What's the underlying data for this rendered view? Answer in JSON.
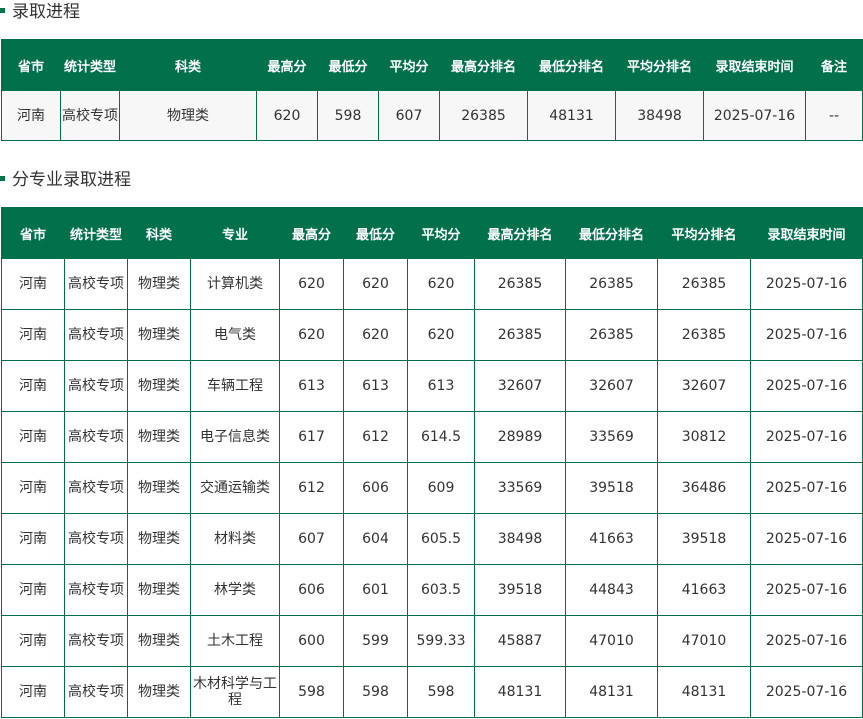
{
  "section1": {
    "title": "录取进程",
    "headers": [
      "省市",
      "统计类型",
      "科类",
      "最高分",
      "最低分",
      "平均分",
      "最高分排名",
      "最低分排名",
      "平均分排名",
      "录取结束时间",
      "备注"
    ],
    "rows": [
      [
        "河南",
        "高校专项",
        "物理类",
        "620",
        "598",
        "607",
        "26385",
        "48131",
        "38498",
        "2025-07-16",
        "--"
      ]
    ]
  },
  "section2": {
    "title": "分专业录取进程",
    "headers": [
      "省市",
      "统计类型",
      "科类",
      "专业",
      "最高分",
      "最低分",
      "平均分",
      "最高分排名",
      "最低分排名",
      "平均分排名",
      "录取结束时间"
    ],
    "rows": [
      [
        "河南",
        "高校专项",
        "物理类",
        "计算机类",
        "620",
        "620",
        "620",
        "26385",
        "26385",
        "26385",
        "2025-07-16"
      ],
      [
        "河南",
        "高校专项",
        "物理类",
        "电气类",
        "620",
        "620",
        "620",
        "26385",
        "26385",
        "26385",
        "2025-07-16"
      ],
      [
        "河南",
        "高校专项",
        "物理类",
        "车辆工程",
        "613",
        "613",
        "613",
        "32607",
        "32607",
        "32607",
        "2025-07-16"
      ],
      [
        "河南",
        "高校专项",
        "物理类",
        "电子信息类",
        "617",
        "612",
        "614.5",
        "28989",
        "33569",
        "30812",
        "2025-07-16"
      ],
      [
        "河南",
        "高校专项",
        "物理类",
        "交通运输类",
        "612",
        "606",
        "609",
        "33569",
        "39518",
        "36486",
        "2025-07-16"
      ],
      [
        "河南",
        "高校专项",
        "物理类",
        "材料类",
        "607",
        "604",
        "605.5",
        "38498",
        "41663",
        "39518",
        "2025-07-16"
      ],
      [
        "河南",
        "高校专项",
        "物理类",
        "林学类",
        "606",
        "601",
        "603.5",
        "39518",
        "44843",
        "41663",
        "2025-07-16"
      ],
      [
        "河南",
        "高校专项",
        "物理类",
        "土木工程",
        "600",
        "599",
        "599.33",
        "45887",
        "47010",
        "47010",
        "2025-07-16"
      ],
      [
        "河南",
        "高校专项",
        "物理类",
        "木材科学与工程",
        "598",
        "598",
        "598",
        "48131",
        "48131",
        "48131",
        "2025-07-16"
      ]
    ]
  },
  "colors": {
    "header_bg": "#00714b",
    "header_text": "#ffffff",
    "border": "#00714b",
    "bullet": "#00714b"
  }
}
